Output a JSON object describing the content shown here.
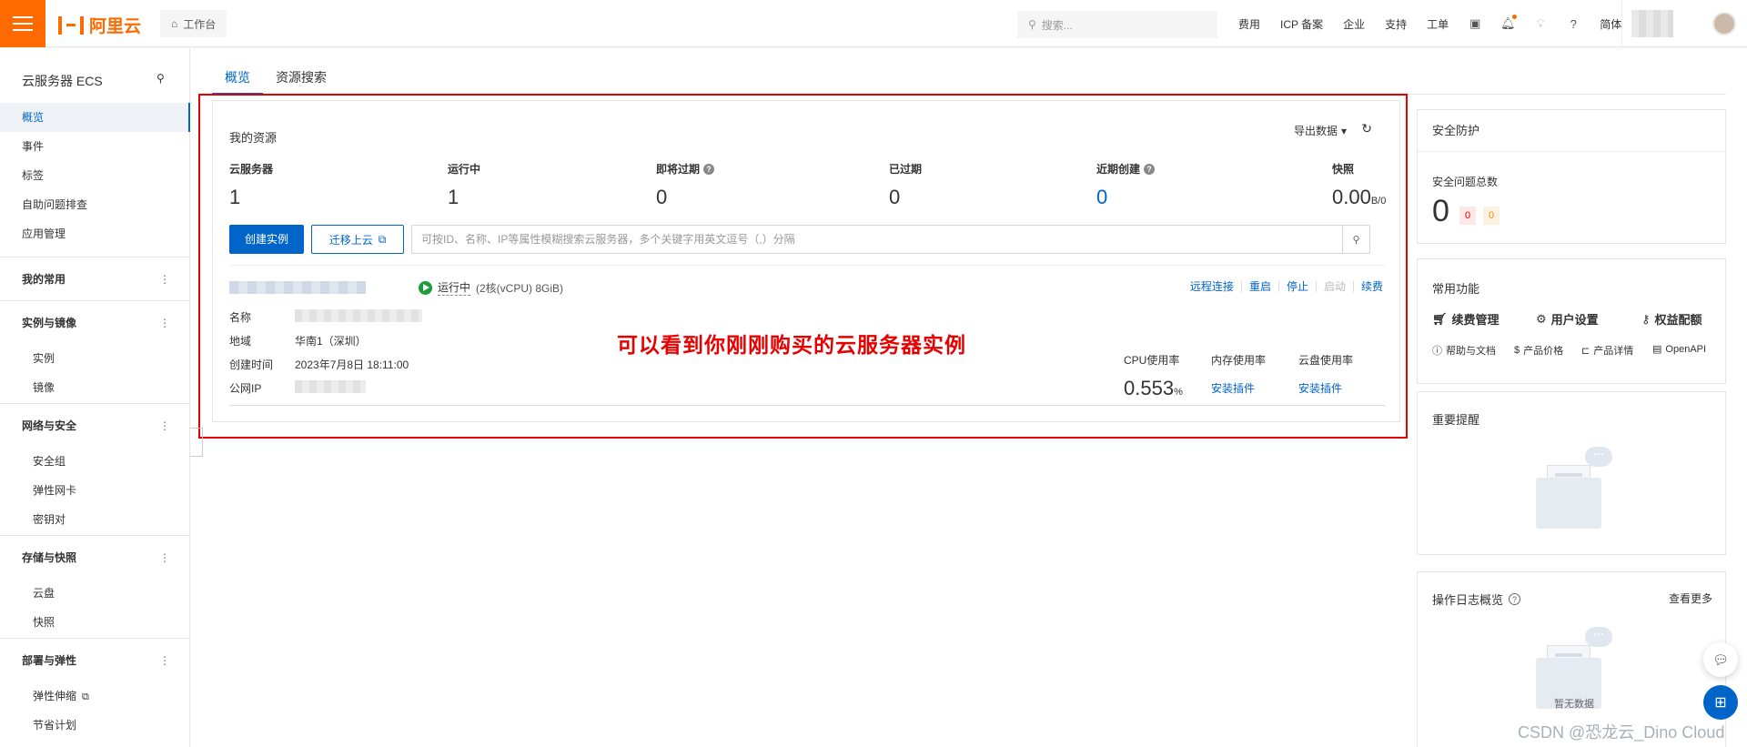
{
  "topbar": {
    "brand": "阿里云",
    "workbench": "工作台",
    "search_placeholder": "搜索...",
    "links": [
      "费用",
      "ICP 备案",
      "企业",
      "支持",
      "工单"
    ],
    "lang": "简体"
  },
  "sidebar": {
    "title": "云服务器 ECS",
    "top_items": [
      "概览",
      "事件",
      "标签",
      "自助问题排查",
      "应用管理"
    ],
    "groups": [
      {
        "label": "我的常用",
        "items": []
      },
      {
        "label": "实例与镜像",
        "items": [
          "实例",
          "镜像"
        ]
      },
      {
        "label": "网络与安全",
        "items": [
          "安全组",
          "弹性网卡",
          "密钥对"
        ]
      },
      {
        "label": "存储与快照",
        "items": [
          "云盘",
          "快照"
        ]
      },
      {
        "label": "部署与弹性",
        "items": [
          "弹性伸缩",
          "节省计划"
        ]
      }
    ]
  },
  "tabs": [
    "概览",
    "资源搜索"
  ],
  "resources": {
    "title": "我的资源",
    "export": "导出数据",
    "stats": [
      {
        "label": "云服务器",
        "value": "1"
      },
      {
        "label": "运行中",
        "value": "1"
      },
      {
        "label": "即将过期",
        "value": "0"
      },
      {
        "label": "已过期",
        "value": "0"
      },
      {
        "label": "近期创建",
        "value": "0"
      },
      {
        "label": "快照",
        "value": "0.00",
        "unit": "B/0"
      }
    ],
    "create_button": "创建实例",
    "migrate_button": "迁移上云",
    "search_placeholder": "可按ID、名称、IP等属性模糊搜索云服务器，多个关键字用英文逗号（,）分隔"
  },
  "instance": {
    "status": "运行中",
    "spec": "(2核(vCPU) 8GiB)",
    "ops": [
      "远程连接",
      "重启",
      "停止",
      "启动",
      "续费"
    ],
    "labels": {
      "name": "名称",
      "region": "地域",
      "created": "创建时间",
      "ip": "公网IP"
    },
    "region": "华南1（深圳）",
    "created": "2023年7月8日 18:11:00",
    "metrics": {
      "cpu_label": "CPU使用率",
      "cpu_value": "0.553",
      "cpu_unit": "%",
      "mem_label": "内存使用率",
      "mem_link": "安装插件",
      "disk_label": "云盘使用率",
      "disk_link": "安装插件"
    }
  },
  "annotation": "可以看到你刚刚购买的云服务器实例",
  "security": {
    "title": "安全防护",
    "label": "安全问题总数",
    "total": "0",
    "high": "0",
    "mid": "0"
  },
  "functions": {
    "title": "常用功能",
    "big": [
      "续费管理",
      "用户设置",
      "权益配额"
    ],
    "small": [
      "帮助与文档",
      "产品价格",
      "产品详情",
      "OpenAPI"
    ]
  },
  "reminder": {
    "title": "重要提醒"
  },
  "oplog": {
    "title": "操作日志概览",
    "more": "查看更多",
    "empty": "暂无数据"
  },
  "watermark": "CSDN @恐龙云_Dino Cloud"
}
